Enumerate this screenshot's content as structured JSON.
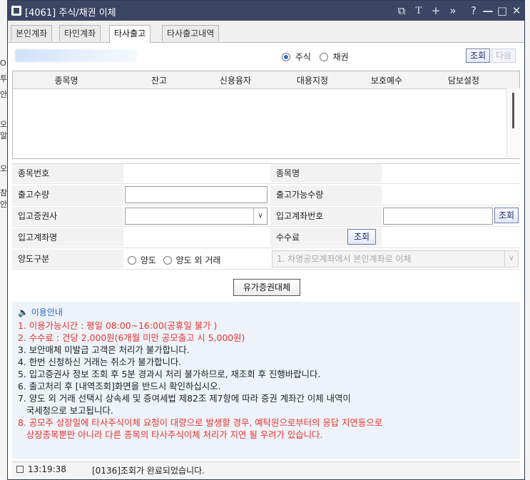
{
  "window": {
    "title": "[4061] 주식/채권 이체",
    "controls": [
      "⧉",
      "T",
      "+",
      "»",
      "?",
      "—",
      "□",
      "✕"
    ]
  },
  "behind_glyphs": [
    "O",
    "",
    "투",
    "안",
    "오",
    "알",
    "오",
    "참",
    "안"
  ],
  "tabs": [
    "본인계좌",
    "타인계좌",
    "타사출고",
    "타사출고내역"
  ],
  "active_tab": 2,
  "asset_type": {
    "stock": "주식",
    "bond": "채권",
    "selected": "stock"
  },
  "buttons": {
    "query": "조회",
    "next": "다음",
    "query2": "조회",
    "query3": "조회",
    "submit": "유가증권대체"
  },
  "grid": {
    "columns": [
      "종목명",
      "잔고",
      "신용융자",
      "대용지정",
      "보호예수",
      "담보설정"
    ]
  },
  "form": {
    "code_label": "종목번호",
    "name_label": "종목명",
    "qty_label": "출고수량",
    "avail_label": "출고가능수량",
    "broker_label": "입고증권사",
    "acct_label": "입고계좌번호",
    "acct_name_label": "입고계좌명",
    "fee_label": "수수료",
    "transfer_label": "양도구분",
    "transfer_opt1": "양도",
    "transfer_opt2": "양도 외 거래",
    "transfer_select": "1. 차명공모계좌에서 본인계좌로 이체"
  },
  "info": {
    "heading": "🔈 이용안내",
    "lines": [
      {
        "text": "1. 이용가능시간 : 평일 08:00~16:00(공휴일 불가 )",
        "color": "#e8322c"
      },
      {
        "text": "2. 수수료 : 건당 2,000원(6개월 미만 공모출고 시 5,000원)",
        "color": "#e8322c"
      },
      {
        "text": "3. 보안매체 미발급 고객은 처리가 불가합니다.",
        "color": "#222222"
      },
      {
        "text": "4. 한번 신청하신 거래는 취소가 불가합니다.",
        "color": "#222222"
      },
      {
        "text": "5. 입고증권사 정보 조회 후 5분 경과시 처리 불가하므로, 재조회 후 진행바랍니다.",
        "color": "#222222"
      },
      {
        "text": "6. 출고처리 후 [내역조회]화면을 반드시 확인하십시오.",
        "color": "#222222"
      },
      {
        "text": "7. 양도 외 거래 선택시 상속세 및 증여세법 제82조 제7항에 따라 증권 계좌간 이체 내역이",
        "color": "#222222"
      },
      {
        "text": "   국세청으로 보고됩니다.",
        "color": "#222222"
      },
      {
        "text": "8. 공모주 상장일에 타사주식이체 요청이 대량으로 발생할 경우, 예탁원으로부터의 응답 지연등으로",
        "color": "#e8322c"
      },
      {
        "text": "   상장종목뿐만 아니라 다른 종목의 타사주식이체 처리가 지연 될 우려가 있습니다.",
        "color": "#e8322c"
      }
    ]
  },
  "status": {
    "time": "13:19:38",
    "message": "[0136]조회가 완료되었습니다."
  }
}
